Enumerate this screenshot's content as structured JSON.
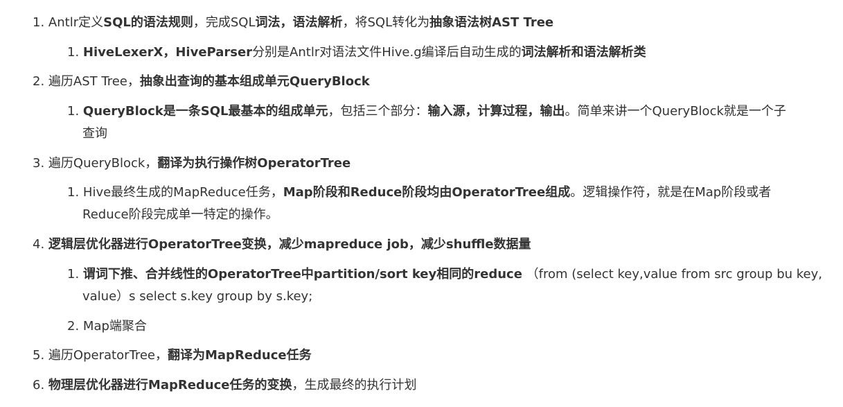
{
  "items": [
    {
      "number": "1.",
      "parts": [
        {
          "text": "Antlr定义",
          "bold": false
        },
        {
          "text": "SQL的语法规则",
          "bold": true
        },
        {
          "text": "，完成SQL",
          "bold": false
        },
        {
          "text": "词法，语法解析",
          "bold": true
        },
        {
          "text": "，将SQL转化为",
          "bold": false
        },
        {
          "text": "抽象语法树AST Tree",
          "bold": true
        }
      ],
      "subitems": [
        {
          "number": "1.",
          "lines": [
            [
              {
                "text": "HiveLexerX，HiveParser",
                "bold": true
              },
              {
                "text": "分别是Antlr对语法文件Hive.g编译后自动生成的",
                "bold": false
              },
              {
                "text": "词法解析和语法解析类",
                "bold": true
              }
            ]
          ]
        }
      ]
    },
    {
      "number": "2.",
      "parts": [
        {
          "text": "遍历AST Tree，",
          "bold": false
        },
        {
          "text": "抽象出查询的基本组成单元QueryBlock",
          "bold": true
        }
      ],
      "subitems": [
        {
          "number": "1.",
          "lines": [
            [
              {
                "text": "QueryBlock是一条SQL最基本的组成单元",
                "bold": true
              },
              {
                "text": "，包括三个部分：",
                "bold": false
              },
              {
                "text": "输入源，计算过程，输出",
                "bold": true
              },
              {
                "text": "。简单来讲一个QueryBlock就是一个子",
                "bold": false
              }
            ],
            [
              {
                "text": "查询",
                "bold": false
              }
            ]
          ]
        }
      ]
    },
    {
      "number": "3.",
      "parts": [
        {
          "text": "遍历QueryBlock，",
          "bold": false
        },
        {
          "text": "翻译为执行操作树OperatorTree",
          "bold": true
        }
      ],
      "subitems": [
        {
          "number": "1.",
          "lines": [
            [
              {
                "text": "Hive最终生成的MapReduce任务，",
                "bold": false
              },
              {
                "text": "Map阶段和Reduce阶段均由OperatorTree组成",
                "bold": true
              },
              {
                "text": "。逻辑操作符，就是在Map阶段或者",
                "bold": false
              }
            ],
            [
              {
                "text": "Reduce阶段完成单一特定的操作。",
                "bold": false
              }
            ]
          ]
        }
      ]
    },
    {
      "number": "4.",
      "parts": [
        {
          "text": "逻辑层优化器进行OperatorTree变换，减少mapreduce job，减少shuffle数据量",
          "bold": true
        }
      ],
      "subitems": [
        {
          "number": "1.",
          "lines": [
            [
              {
                "text": "谓词下推、合并线性的OperatorTree中partition/sort key相同的reduce",
                "bold": true
              },
              {
                "text": "  （from (select key,value from src group bu key,",
                "bold": false
              }
            ],
            [
              {
                "text": "value）s select s.key group by s.key;",
                "bold": false
              }
            ]
          ]
        },
        {
          "number": "2.",
          "lines": [
            [
              {
                "text": "Map端聚合",
                "bold": false
              }
            ]
          ]
        }
      ]
    },
    {
      "number": "5.",
      "parts": [
        {
          "text": "遍历OperatorTree，",
          "bold": false
        },
        {
          "text": "翻译为MapReduce任务",
          "bold": true
        }
      ],
      "subitems": []
    },
    {
      "number": "6.",
      "parts": [
        {
          "text": "物理层优化器进行MapReduce任务的变换",
          "bold": true
        },
        {
          "text": "，生成最终的执行计划",
          "bold": false
        }
      ],
      "subitems": []
    }
  ]
}
